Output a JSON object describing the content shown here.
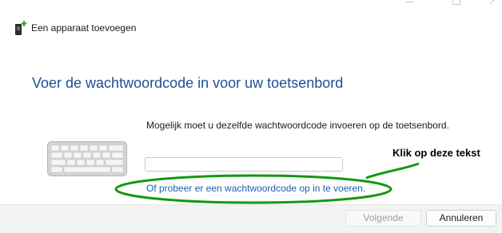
{
  "window": {
    "title": "Een apparaat toevoegen",
    "title_icon": "device-add-icon"
  },
  "main": {
    "heading": "Voer de wachtwoordcode in voor uw toetsenbord",
    "instruction": "Mogelijk moet u dezelfde wachtwoordcode invoeren op de toetsenbord.",
    "passcode_value": "",
    "passcode_placeholder": "",
    "alt_link": "Of probeer er een wachtwoordcode op in te voeren.",
    "keyboard_icon": "keyboard-icon"
  },
  "annotation": {
    "label": "Klik op deze tekst",
    "color": "#119911"
  },
  "footer": {
    "next_label": "Volgende",
    "next_enabled": false,
    "cancel_label": "Annuleren"
  },
  "colors": {
    "heading": "#1f4e95",
    "link": "#1e5fb0",
    "footer_bg": "#f3f3f3"
  }
}
